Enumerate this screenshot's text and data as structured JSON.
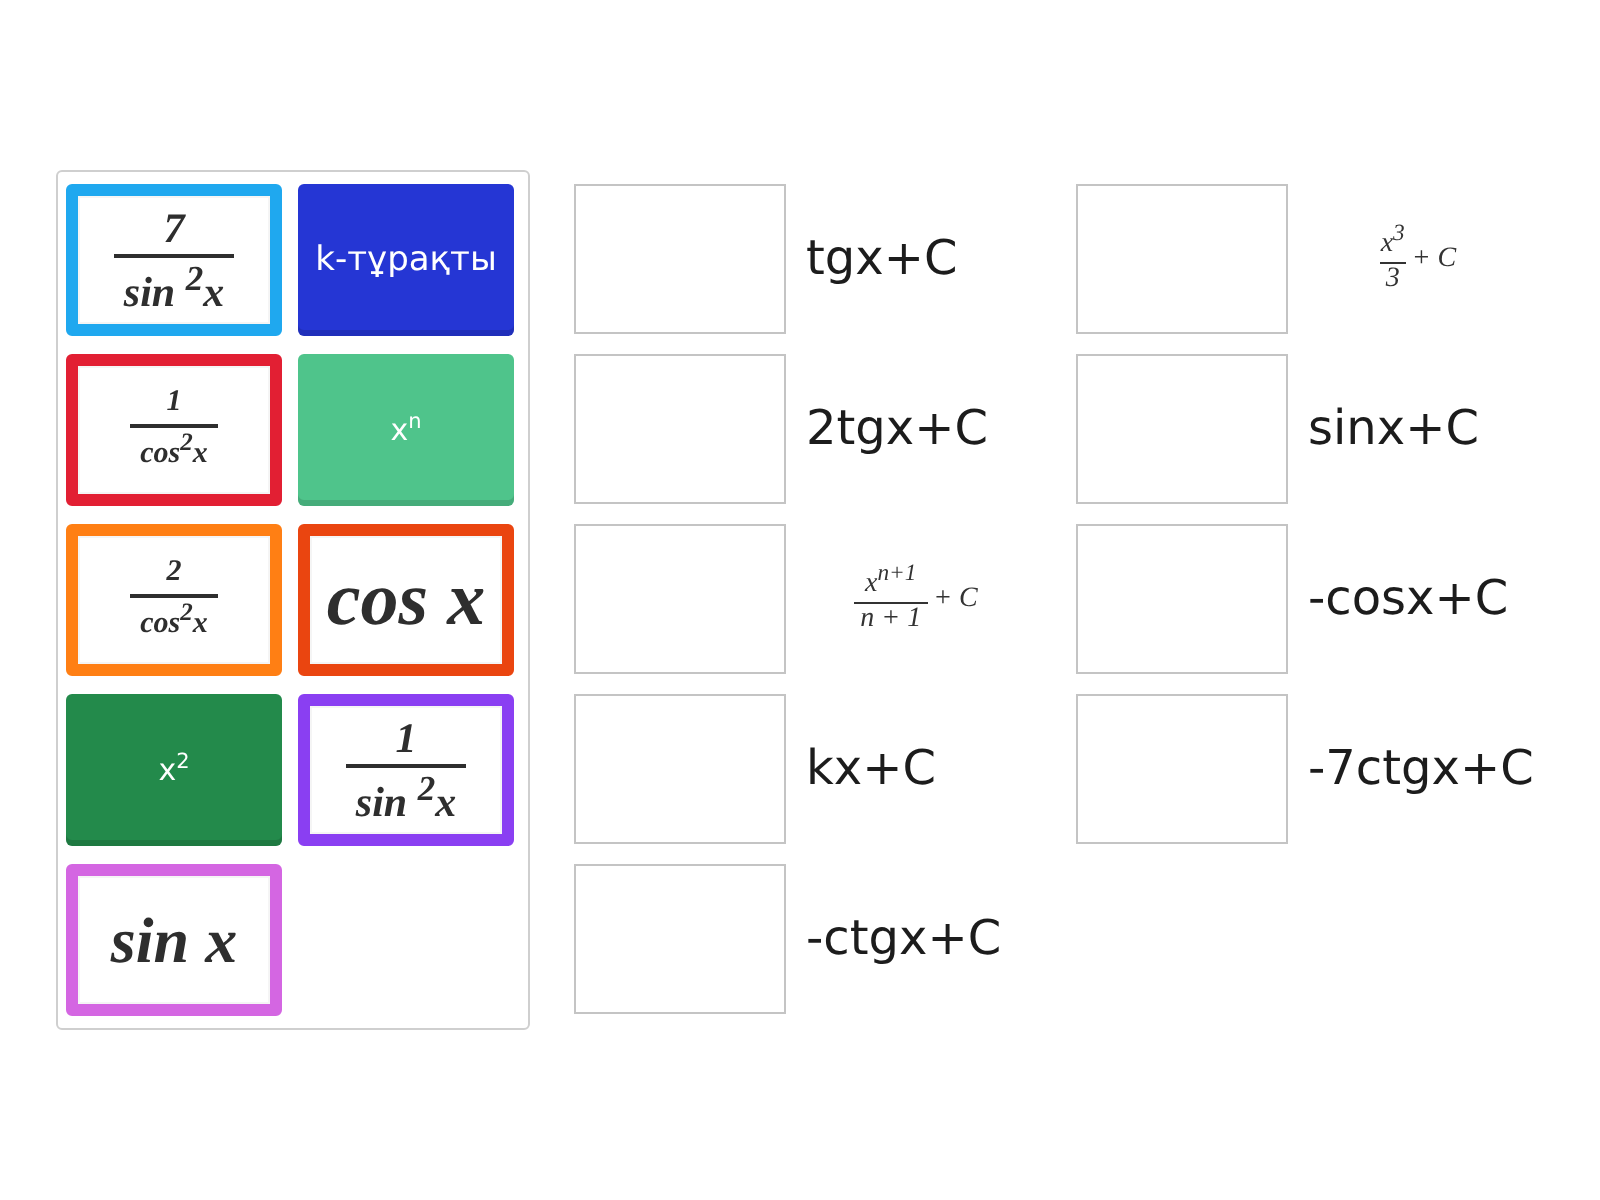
{
  "tile_bank": {
    "tiles": [
      {
        "kind": "fraction",
        "numerator": "7",
        "denominator": "sin $^{2}$x",
        "color": "#1fa8ef"
      },
      {
        "kind": "text",
        "text": "k-тұрақты",
        "color": "#2536d4"
      },
      {
        "kind": "fraction",
        "numerator": "1",
        "denominator": "cos$^{2}$x",
        "color": "#e21f33"
      },
      {
        "kind": "text",
        "text": "x$^{n}$",
        "color": "#4fc48b"
      },
      {
        "kind": "fraction",
        "numerator": "2",
        "denominator": "cos$^{2}$x",
        "color": "#ff7f14"
      },
      {
        "kind": "formula",
        "text": "cos x",
        "color": "#ea4510"
      },
      {
        "kind": "text",
        "text": "x$^{2}$",
        "color": "#238a4b"
      },
      {
        "kind": "fraction",
        "numerator": "1",
        "denominator": "sin $^{2}$x",
        "color": "#8a3ff2"
      },
      {
        "kind": "formula",
        "text": "sin x",
        "color": "#d466e2"
      }
    ]
  },
  "targets": [
    {
      "kind": "text",
      "label": "tgx+C"
    },
    {
      "kind": "formula",
      "numerator": "x$^{3}$",
      "denominator": "3",
      "suffix": "+ C"
    },
    {
      "kind": "text",
      "label": "2tgx+C"
    },
    {
      "kind": "text",
      "label": "sinx+C"
    },
    {
      "kind": "formula",
      "numerator": "x$^{n+1}$",
      "denominator": "n + 1",
      "suffix": "+ C"
    },
    {
      "kind": "text",
      "label": "-cosx+C"
    },
    {
      "kind": "text",
      "label": "kx+C"
    },
    {
      "kind": "text",
      "label": "-7ctgx+C"
    },
    {
      "kind": "text",
      "label": "-ctgx+C"
    }
  ]
}
